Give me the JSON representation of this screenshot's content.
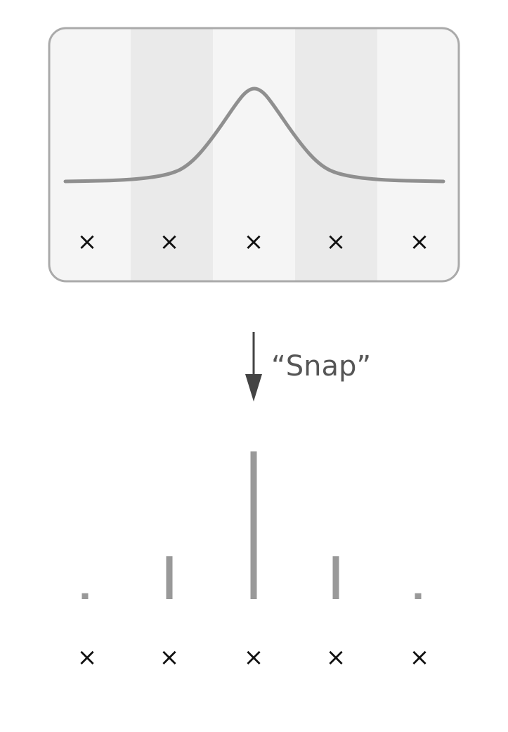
{
  "annotation": {
    "label": "“Snap”"
  },
  "colors": {
    "panel_fill": "#f5f5f5",
    "band_fill": "#eaeaea",
    "panel_border": "#aaaaaa",
    "curve": "#8f8f8f",
    "bars": "#999999",
    "arrow": "#444444",
    "marks": "#111111"
  },
  "grid_points": {
    "marker_symbol": "×",
    "count": 5
  },
  "snapped_weights": [
    0.04,
    0.29,
    1.0,
    0.29,
    0.04
  ]
}
